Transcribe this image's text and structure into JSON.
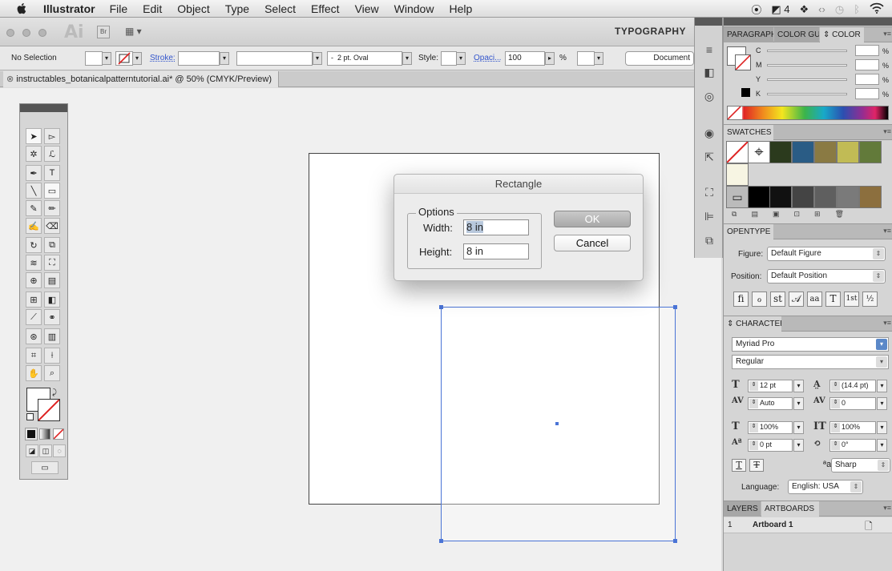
{
  "menubar": {
    "app_name": "Illustrator",
    "items": [
      "File",
      "Edit",
      "Object",
      "Type",
      "Select",
      "Effect",
      "View",
      "Window",
      "Help"
    ],
    "status_text": "4"
  },
  "appbar": {
    "logo": "Ai",
    "bridge": "Br",
    "workspace": "TYPOGRAPHY"
  },
  "control": {
    "selection": "No Selection",
    "stroke_label": "Stroke:",
    "brush": "2 pt. Oval",
    "brush_prefix": "-",
    "style_label": "Style:",
    "opacity_label": "Opaci...",
    "opacity_value": "100",
    "opacity_unit": "%",
    "document_button": "Document"
  },
  "document": {
    "tab_title": "instructables_botanicalpatterntutorial.ai* @ 50% (CMYK/Preview)"
  },
  "dialog": {
    "title": "Rectangle",
    "options_legend": "Options",
    "width_label": "Width:",
    "width_value": "8 in",
    "height_label": "Height:",
    "height_value": "8 in",
    "ok": "OK",
    "cancel": "Cancel"
  },
  "panels": {
    "color_tabs": [
      "PARAGRAPH",
      "COLOR GUI",
      "COLOR"
    ],
    "color_channels": [
      "C",
      "M",
      "Y",
      "K"
    ],
    "percent": "%",
    "swatches_title": "SWATCHES",
    "swatch_colors": [
      "#2b3a1d",
      "#2a5c85",
      "#8a7a43",
      "#c1bb55",
      "#627a3a",
      "#f7f5e3",
      "#000000",
      "#111111",
      "#444444",
      "#5f5f5f",
      "#7a7a7a",
      "#8c6f3e"
    ],
    "opentype_title": "OPENTYPE",
    "figure_label": "Figure:",
    "figure_value": "Default Figure",
    "position_label": "Position:",
    "position_value": "Default Position",
    "ot_glyphs": [
      "fi",
      "ℴ",
      "st",
      "𝒜",
      "aa",
      "T",
      "1st",
      "½"
    ],
    "character_title": "CHARACTER",
    "font_family": "Myriad Pro",
    "font_style": "Regular",
    "font_size": "12 pt",
    "leading": "(14.4 pt)",
    "kerning": "Auto",
    "tracking": "0",
    "vscale": "100%",
    "hscale": "100%",
    "baseline": "0 pt",
    "rotation": "0°",
    "antialias": "Sharp",
    "language_label": "Language:",
    "language_value": "English: USA",
    "layers_tab": "LAYERS",
    "artboards_tab": "ARTBOARDS",
    "artboard_number": "1",
    "artboard_name": "Artboard 1"
  }
}
